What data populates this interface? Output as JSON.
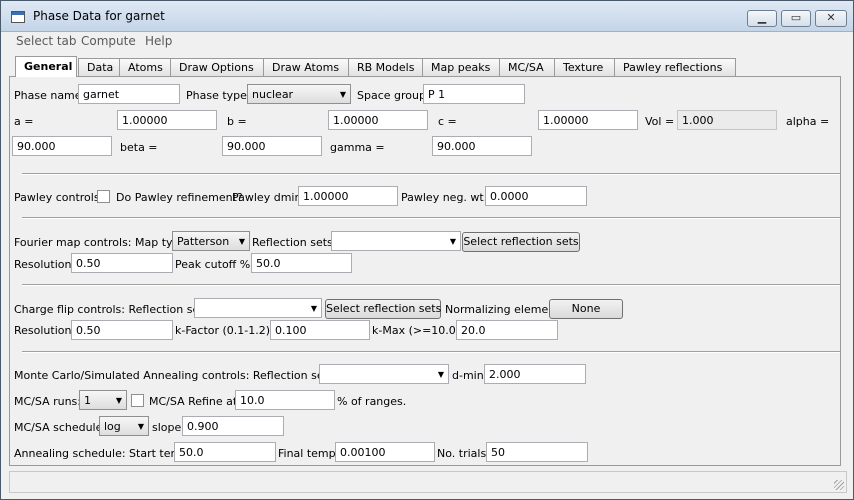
{
  "window": {
    "title": "Phase Data for garnet"
  },
  "menu": [
    "Select tab",
    "Compute",
    "Help"
  ],
  "tabs": [
    "General",
    "Data",
    "Atoms",
    "Draw Options",
    "Draw Atoms",
    "RB Models",
    "Map peaks",
    "MC/SA",
    "Texture",
    "Pawley reflections"
  ],
  "general": {
    "phase_name_label": "Phase name:",
    "phase_name": "garnet",
    "phase_type_label": "Phase type:",
    "phase_type": "nuclear",
    "space_group_label": "Space group:",
    "space_group": "P 1",
    "a_label": "a =",
    "a": "1.00000",
    "b_label": "b =",
    "b": "1.00000",
    "c_label": "c =",
    "c": "1.00000",
    "vol_label": "Vol =",
    "vol": "1.000",
    "alpha_label": "alpha =",
    "alpha": "90.000",
    "beta_label": "beta =",
    "beta": "90.000",
    "gamma_label": "gamma =",
    "gamma": "90.000"
  },
  "pawley": {
    "controls_label": "Pawley controls:",
    "do_refine_label": "Do Pawley refinement?",
    "dmin_label": "Pawley dmin:",
    "dmin": "1.00000",
    "neg_wt_label": "Pawley neg. wt.:",
    "neg_wt": "0.0000"
  },
  "fourier": {
    "controls_label": "Fourier map controls: Map type:",
    "map_type": "Patterson",
    "refl_sets_label": "Reflection sets:",
    "refl_sets": "",
    "select_button": "Select reflection sets",
    "resolution_label": "Resolution:",
    "resolution": "0.50",
    "peak_cutoff_label": "Peak cutoff %:",
    "peak_cutoff": "50.0"
  },
  "charge_flip": {
    "controls_label": "Charge flip controls: Reflection sets:",
    "refl_sets": "",
    "select_button": "Select reflection sets",
    "norm_label": "Normalizing element:",
    "norm_button": "None",
    "resolution_label": "Resolution:",
    "resolution": "0.50",
    "kfactor_label": "k-Factor (0.1-1.2):",
    "kfactor": "0.100",
    "kmax_label": "k-Max (>=10.0):",
    "kmax": "20.0"
  },
  "mcsa": {
    "controls_label": "Monte Carlo/Simulated Annealing controls: Reflection set from:",
    "refl_set": "",
    "dmin_label": "d-min:",
    "dmin": "2.000",
    "runs_label": "MC/SA runs:",
    "runs": "1",
    "refine_label": "MC/SA Refine at",
    "refine_pct": "10.0",
    "ranges_label": "% of ranges.",
    "schedule_label": "MC/SA schedule:",
    "schedule": "log",
    "slope_label": "slope:",
    "slope": "0.900",
    "annealing_label": "Annealing schedule:  Start temp:",
    "start_temp": "50.0",
    "final_temp_label": "Final temp:",
    "final_temp": "0.00100",
    "trials_label": "No. trials:",
    "trials": "50"
  }
}
